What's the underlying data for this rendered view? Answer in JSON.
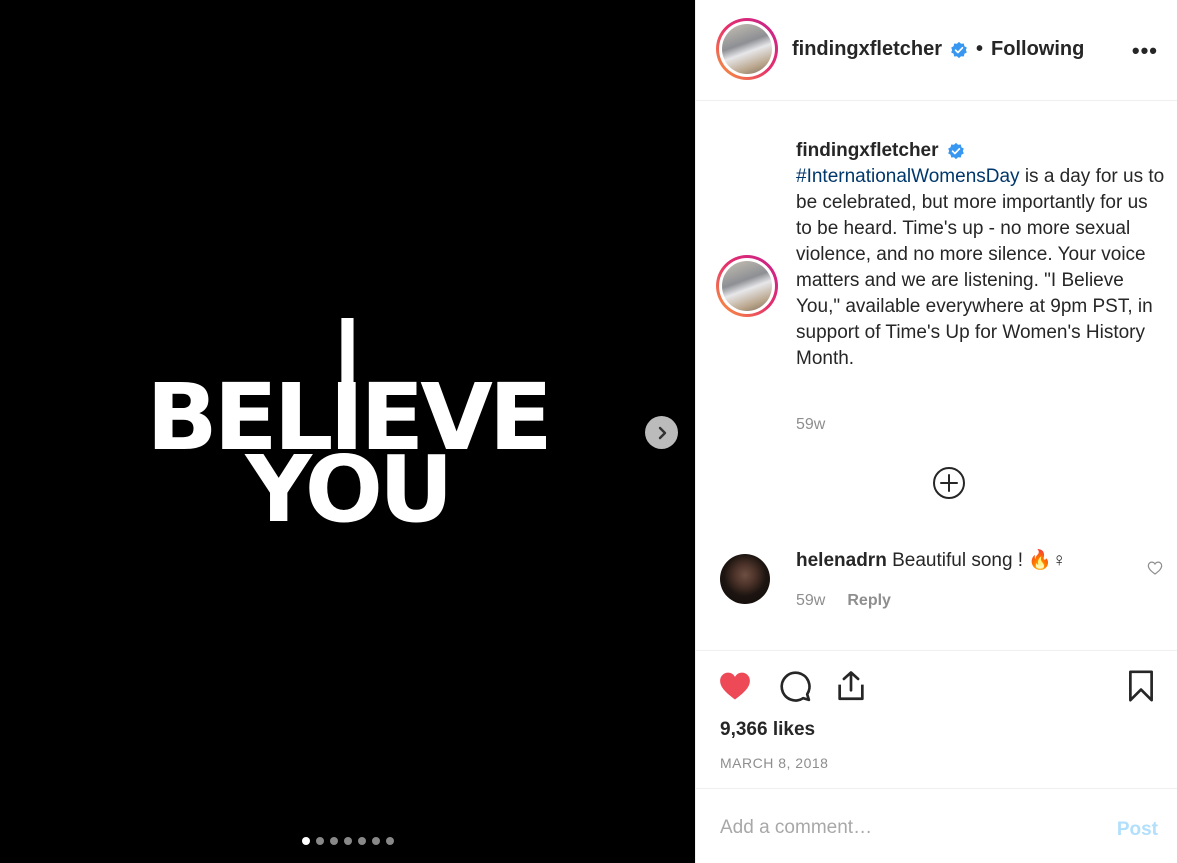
{
  "media": {
    "art_lines": [
      "I",
      "BELIEVE",
      "YOU"
    ],
    "carousel_total": 7,
    "carousel_active": 1
  },
  "header": {
    "username": "findingxfletcher",
    "separator": "•",
    "follow_status": "Following",
    "more_label": "•••"
  },
  "caption": {
    "username": "findingxfletcher",
    "hashtag": "#InternationalWomensDay",
    "text": " is a day for us to be celebrated, but more importantly for us to be heard. Time's up - no more sexual violence, and no more silence. Your voice matters and we are listening. \"I Believe You,\" available everywhere at 9pm PST, in support of Time's Up for Women's History Month.",
    "time": "59w"
  },
  "comments": [
    {
      "username": "helenadrn",
      "text": "Beautiful song ! 🔥♀",
      "time": "59w",
      "reply_label": "Reply"
    }
  ],
  "actions": {
    "likes": "9,366 likes",
    "date": "MARCH 8, 2018",
    "liked": true
  },
  "comment_box": {
    "placeholder": "Add a comment…",
    "post_label": "Post"
  },
  "colors": {
    "like_red": "#ed4956",
    "verified_blue": "#3897f0",
    "hashtag_blue": "#00376b",
    "post_disabled": "#b2dffc"
  }
}
